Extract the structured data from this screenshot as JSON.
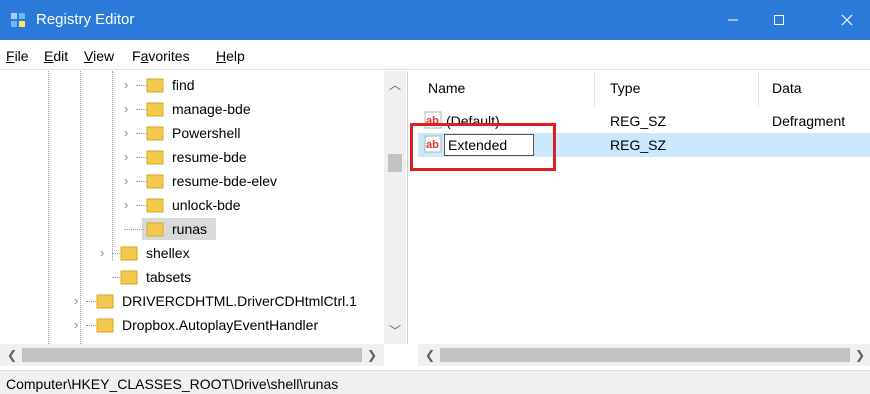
{
  "window": {
    "title": "Registry Editor"
  },
  "menu": [
    {
      "key": "F",
      "rest": "ile"
    },
    {
      "key": "E",
      "rest": "dit"
    },
    {
      "key": "V",
      "rest": "iew"
    },
    {
      "key": "",
      "pre": "F",
      "key2": "a",
      "rest": "vorites"
    },
    {
      "key": "H",
      "rest": "elp"
    }
  ],
  "tree": {
    "items": [
      {
        "label": "find"
      },
      {
        "label": "manage-bde"
      },
      {
        "label": "Powershell"
      },
      {
        "label": "resume-bde"
      },
      {
        "label": "resume-bde-elev"
      },
      {
        "label": "unlock-bde"
      },
      {
        "label": "runas"
      },
      {
        "label": "shellex"
      },
      {
        "label": "tabsets"
      },
      {
        "label": "DRIVERCDHTML.DriverCDHtmlCtrl.1"
      },
      {
        "label": "Dropbox.AutoplayEventHandler"
      }
    ]
  },
  "list": {
    "columns": {
      "name": "Name",
      "type": "Type",
      "data": "Data"
    },
    "rows": [
      {
        "name": "(Default)",
        "type": "REG_SZ",
        "data": "Defragment"
      },
      {
        "name": "Extended",
        "type": "REG_SZ",
        "data": ""
      }
    ]
  },
  "status": {
    "path": "Computer\\HKEY_CLASSES_ROOT\\Drive\\shell\\runas"
  },
  "colors": {
    "titlebar": "#2b79d8",
    "selection": "#cce8ff",
    "highlight": "#e02020",
    "folder": "#f2c94c"
  }
}
